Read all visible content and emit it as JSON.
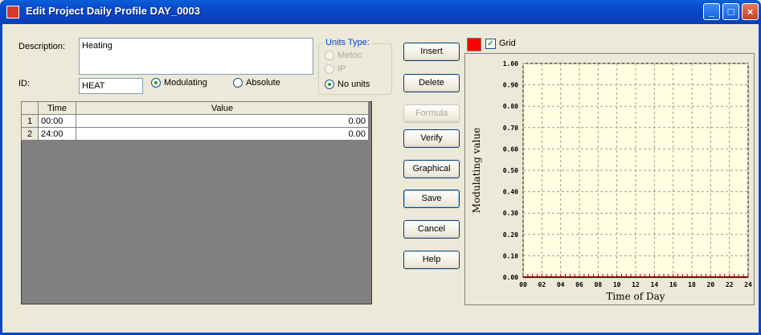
{
  "window": {
    "title": "Edit Project Daily Profile DAY_0003",
    "controls": [
      "minimize",
      "maximize",
      "close"
    ]
  },
  "form": {
    "description_label": "Description:",
    "description_value": "Heating",
    "id_label": "ID:",
    "id_value": "HEAT",
    "mode_options": [
      {
        "label": "Modulating",
        "selected": true
      },
      {
        "label": "Absolute",
        "selected": false
      }
    ],
    "units_type": {
      "title": "Units Type:",
      "options": [
        {
          "label": "Metric",
          "enabled": false,
          "selected": false
        },
        {
          "label": "IP",
          "enabled": false,
          "selected": false
        },
        {
          "label": "No units",
          "enabled": true,
          "selected": true
        }
      ]
    }
  },
  "table": {
    "columns": [
      "Time",
      "Value"
    ],
    "rows": [
      {
        "num": "1",
        "time": "00:00",
        "value": "0.00"
      },
      {
        "num": "2",
        "time": "24:00",
        "value": "0.00"
      }
    ]
  },
  "buttons": {
    "insert": "Insert",
    "delete": "Delete",
    "formula": "Formula",
    "verify": "Verify",
    "graphical": "Graphical",
    "save": "Save",
    "cancel": "Cancel",
    "help": "Help"
  },
  "chart_options": {
    "grid_label": "Grid",
    "grid_checked": true,
    "line_color": "#ff0000"
  },
  "chart_data": {
    "type": "line",
    "ylabel": "Modulating value",
    "xlabel": "Time of Day",
    "ylim": [
      0,
      1.0
    ],
    "xlim": [
      0,
      24
    ],
    "yticks": [
      "0.00",
      "0.10",
      "0.20",
      "0.30",
      "0.40",
      "0.50",
      "0.60",
      "0.70",
      "0.80",
      "0.90",
      "1.00"
    ],
    "xticks": [
      "00",
      "02",
      "04",
      "06",
      "08",
      "10",
      "12",
      "14",
      "16",
      "18",
      "20",
      "22",
      "24"
    ],
    "grid": true,
    "series": [
      {
        "x": [
          0,
          24
        ],
        "values": [
          0.0,
          0.0
        ],
        "color": "#8b0000"
      }
    ]
  }
}
